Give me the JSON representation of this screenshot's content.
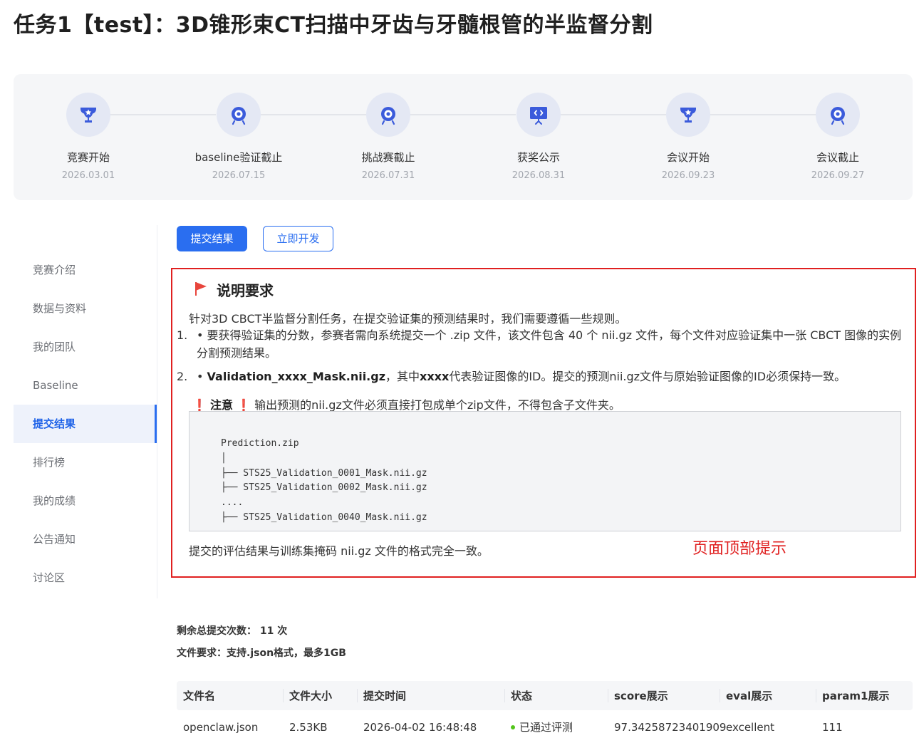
{
  "page": {
    "title": "任务1【test】：3D锥形束CT扫描中牙齿与牙髓根管的半监督分割"
  },
  "timeline": [
    {
      "name": "竞赛开始",
      "date": "2026.03.01",
      "icon": "trophy-icon"
    },
    {
      "name": "baseline验证截止",
      "date": "2026.07.15",
      "icon": "target-icon"
    },
    {
      "name": "挑战赛截止",
      "date": "2026.07.31",
      "icon": "target-icon"
    },
    {
      "name": "获奖公示",
      "date": "2026.08.31",
      "icon": "presentation-icon"
    },
    {
      "name": "会议开始",
      "date": "2026.09.23",
      "icon": "trophy-icon"
    },
    {
      "name": "会议截止",
      "date": "2026.09.27",
      "icon": "target-icon"
    }
  ],
  "sidebar": {
    "items": [
      {
        "label": "竞赛介绍"
      },
      {
        "label": "数据与资料"
      },
      {
        "label": "我的团队"
      },
      {
        "label": "Baseline"
      },
      {
        "label": "提交结果",
        "active": true
      },
      {
        "label": "排行榜"
      },
      {
        "label": "我的成绩"
      },
      {
        "label": "公告通知"
      },
      {
        "label": "讨论区"
      }
    ]
  },
  "actions": {
    "submit_label": "提交结果",
    "develop_label": "立即开发"
  },
  "notice": {
    "title": "说明要求",
    "intro": "针对3D CBCT半监督分割任务，在提交验证集的预测结果时，我们需要遵循一些规则。",
    "item1_num": "1.",
    "item1": "• 要获得验证集的分数，参赛者需向系统提交一个 .zip 文件，该文件包含 40 个 nii.gz 文件，每个文件对应验证集中一张 CBCT 图像的实例分割预测结果。",
    "item2_num": "2.",
    "item2_bullet": "• ",
    "item2_bold": "Validation_xxxx_Mask.nii.gz",
    "item2_mid": "，其中",
    "item2_bold2": "xxxx",
    "item2_rest": "代表验证图像的ID。提交的预测nii.gz文件与原始验证图像的ID必须保持一致。",
    "warn_mark": "❗",
    "warn_label": "注意",
    "warn_text": "输出预测的nii.gz文件必须直接打包成单个zip文件，不得包含子文件夹。",
    "code": "Prediction.zip\n│\n├── STS25_Validation_0001_Mask.nii.gz\n├── STS25_Validation_0002_Mask.nii.gz\n....\n├── STS25_Validation_0040_Mask.nii.gz",
    "footer": "提交的评估结果与训练集掩码 nii.gz 文件的格式完全一致。",
    "annotation": "页面顶部提示"
  },
  "info": {
    "remaining": "剩余总提交次数： 11 次",
    "file_req": "文件要求：支持.json格式，最多1GB"
  },
  "table": {
    "columns": [
      "文件名",
      "文件大小",
      "提交时间",
      "状态",
      "score展示",
      "eval展示",
      "param1展示"
    ],
    "rows": [
      [
        "openclaw.json",
        "2.53KB",
        "2026-04-02 16:48:48",
        "已通过评测",
        "97.34258723401909",
        "excellent",
        "111"
      ]
    ]
  },
  "colors": {
    "primary": "#2a6ef0",
    "annotation": "#e02020",
    "success": "#52c41a",
    "icon_bg": "#e4e8f4"
  }
}
